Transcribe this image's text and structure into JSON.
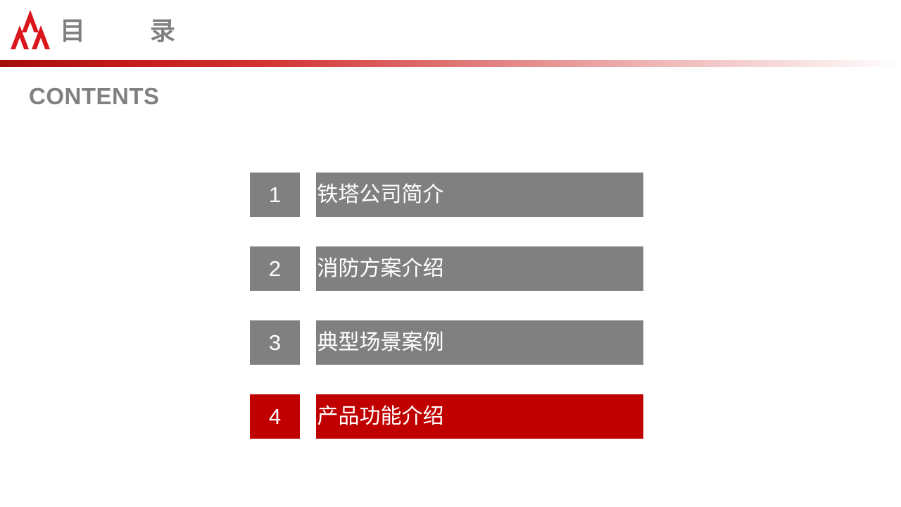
{
  "header": {
    "title": "目　录",
    "logo_icon": "china-tower-triple-peak-logo",
    "logo_color": "#d9161c",
    "title_color": "#808080",
    "rule_gradient_from": "#a50c0c",
    "rule_gradient_to": "#ffffff"
  },
  "section": {
    "label": "CONTENTS",
    "label_color": "#808080"
  },
  "contents": {
    "inactive_color": "#808080",
    "active_color": "#c00000",
    "items": [
      {
        "number": "1",
        "label": "铁塔公司简介",
        "state": "inactive"
      },
      {
        "number": "2",
        "label": "消防方案介绍",
        "state": "inactive"
      },
      {
        "number": "3",
        "label": "典型场景案例",
        "state": "inactive"
      },
      {
        "number": "4",
        "label": "产品功能介绍",
        "state": "active"
      }
    ]
  }
}
